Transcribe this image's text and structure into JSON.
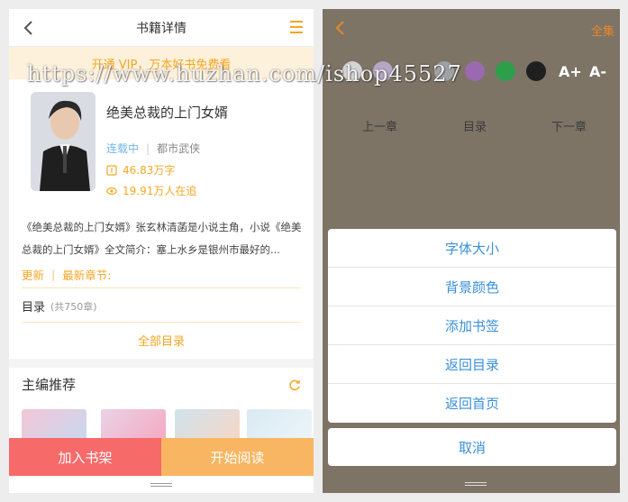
{
  "left": {
    "header": {
      "title": "书籍详情"
    },
    "vip_banner": "开通 VIP，万本好书免费看",
    "book": {
      "title": "绝美总裁的上门女婿",
      "status": "连载中",
      "genre": "都市武侠",
      "word_count": "46.83万字",
      "readers": "19.91万人在追"
    },
    "intro": "《绝美总裁的上门女婿》张玄林清菡是小说主角，小说《绝美总裁的上门女婿》全文简介：塞上水乡是银州市最好的...",
    "update": {
      "label": "更新",
      "latest": "最新章节:"
    },
    "toc": {
      "label": "目录",
      "count": "(共750章)"
    },
    "all_toc": "全部目录",
    "recommend": {
      "title": "主编推荐"
    },
    "buttons": {
      "add_shelf": "加入书架",
      "start_read": "开始阅读"
    }
  },
  "right": {
    "top": {
      "all_label": "全集"
    },
    "swatch_colors": [
      "#d4d4d4",
      "#b6a6c6",
      "#9fa3a6",
      "#9a6ab0",
      "#2f9e4a",
      "#1f1f1f"
    ],
    "font_larger": "A+",
    "font_smaller": "A-",
    "chapter_nav": {
      "prev": "上一章",
      "toc": "目录",
      "next": "下一章"
    },
    "menu": [
      "字体大小",
      "背景颜色",
      "添加书签",
      "返回目录",
      "返回首页"
    ],
    "cancel": "取消"
  },
  "watermark": "https://www.huzhan.com/ishop45527",
  "colors": {
    "accent": "#f5a623",
    "shelf": "#f66a6a",
    "read": "#f8b562",
    "link": "#3a8fd9"
  }
}
